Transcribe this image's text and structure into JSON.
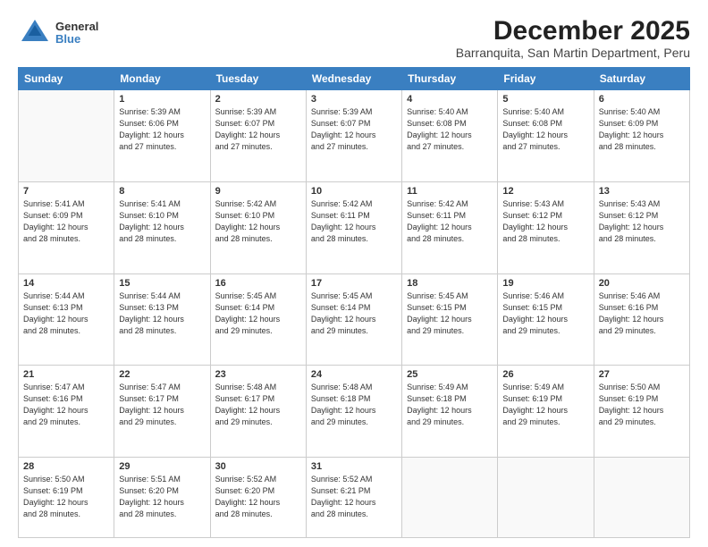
{
  "logo": {
    "general": "General",
    "blue": "Blue"
  },
  "title": "December 2025",
  "subtitle": "Barranquita, San Martin Department, Peru",
  "headers": [
    "Sunday",
    "Monday",
    "Tuesday",
    "Wednesday",
    "Thursday",
    "Friday",
    "Saturday"
  ],
  "weeks": [
    [
      {
        "day": "",
        "info": ""
      },
      {
        "day": "1",
        "info": "Sunrise: 5:39 AM\nSunset: 6:06 PM\nDaylight: 12 hours\nand 27 minutes."
      },
      {
        "day": "2",
        "info": "Sunrise: 5:39 AM\nSunset: 6:07 PM\nDaylight: 12 hours\nand 27 minutes."
      },
      {
        "day": "3",
        "info": "Sunrise: 5:39 AM\nSunset: 6:07 PM\nDaylight: 12 hours\nand 27 minutes."
      },
      {
        "day": "4",
        "info": "Sunrise: 5:40 AM\nSunset: 6:08 PM\nDaylight: 12 hours\nand 27 minutes."
      },
      {
        "day": "5",
        "info": "Sunrise: 5:40 AM\nSunset: 6:08 PM\nDaylight: 12 hours\nand 27 minutes."
      },
      {
        "day": "6",
        "info": "Sunrise: 5:40 AM\nSunset: 6:09 PM\nDaylight: 12 hours\nand 28 minutes."
      }
    ],
    [
      {
        "day": "7",
        "info": "Sunrise: 5:41 AM\nSunset: 6:09 PM\nDaylight: 12 hours\nand 28 minutes."
      },
      {
        "day": "8",
        "info": "Sunrise: 5:41 AM\nSunset: 6:10 PM\nDaylight: 12 hours\nand 28 minutes."
      },
      {
        "day": "9",
        "info": "Sunrise: 5:42 AM\nSunset: 6:10 PM\nDaylight: 12 hours\nand 28 minutes."
      },
      {
        "day": "10",
        "info": "Sunrise: 5:42 AM\nSunset: 6:11 PM\nDaylight: 12 hours\nand 28 minutes."
      },
      {
        "day": "11",
        "info": "Sunrise: 5:42 AM\nSunset: 6:11 PM\nDaylight: 12 hours\nand 28 minutes."
      },
      {
        "day": "12",
        "info": "Sunrise: 5:43 AM\nSunset: 6:12 PM\nDaylight: 12 hours\nand 28 minutes."
      },
      {
        "day": "13",
        "info": "Sunrise: 5:43 AM\nSunset: 6:12 PM\nDaylight: 12 hours\nand 28 minutes."
      }
    ],
    [
      {
        "day": "14",
        "info": "Sunrise: 5:44 AM\nSunset: 6:13 PM\nDaylight: 12 hours\nand 28 minutes."
      },
      {
        "day": "15",
        "info": "Sunrise: 5:44 AM\nSunset: 6:13 PM\nDaylight: 12 hours\nand 28 minutes."
      },
      {
        "day": "16",
        "info": "Sunrise: 5:45 AM\nSunset: 6:14 PM\nDaylight: 12 hours\nand 29 minutes."
      },
      {
        "day": "17",
        "info": "Sunrise: 5:45 AM\nSunset: 6:14 PM\nDaylight: 12 hours\nand 29 minutes."
      },
      {
        "day": "18",
        "info": "Sunrise: 5:45 AM\nSunset: 6:15 PM\nDaylight: 12 hours\nand 29 minutes."
      },
      {
        "day": "19",
        "info": "Sunrise: 5:46 AM\nSunset: 6:15 PM\nDaylight: 12 hours\nand 29 minutes."
      },
      {
        "day": "20",
        "info": "Sunrise: 5:46 AM\nSunset: 6:16 PM\nDaylight: 12 hours\nand 29 minutes."
      }
    ],
    [
      {
        "day": "21",
        "info": "Sunrise: 5:47 AM\nSunset: 6:16 PM\nDaylight: 12 hours\nand 29 minutes."
      },
      {
        "day": "22",
        "info": "Sunrise: 5:47 AM\nSunset: 6:17 PM\nDaylight: 12 hours\nand 29 minutes."
      },
      {
        "day": "23",
        "info": "Sunrise: 5:48 AM\nSunset: 6:17 PM\nDaylight: 12 hours\nand 29 minutes."
      },
      {
        "day": "24",
        "info": "Sunrise: 5:48 AM\nSunset: 6:18 PM\nDaylight: 12 hours\nand 29 minutes."
      },
      {
        "day": "25",
        "info": "Sunrise: 5:49 AM\nSunset: 6:18 PM\nDaylight: 12 hours\nand 29 minutes."
      },
      {
        "day": "26",
        "info": "Sunrise: 5:49 AM\nSunset: 6:19 PM\nDaylight: 12 hours\nand 29 minutes."
      },
      {
        "day": "27",
        "info": "Sunrise: 5:50 AM\nSunset: 6:19 PM\nDaylight: 12 hours\nand 29 minutes."
      }
    ],
    [
      {
        "day": "28",
        "info": "Sunrise: 5:50 AM\nSunset: 6:19 PM\nDaylight: 12 hours\nand 28 minutes."
      },
      {
        "day": "29",
        "info": "Sunrise: 5:51 AM\nSunset: 6:20 PM\nDaylight: 12 hours\nand 28 minutes."
      },
      {
        "day": "30",
        "info": "Sunrise: 5:52 AM\nSunset: 6:20 PM\nDaylight: 12 hours\nand 28 minutes."
      },
      {
        "day": "31",
        "info": "Sunrise: 5:52 AM\nSunset: 6:21 PM\nDaylight: 12 hours\nand 28 minutes."
      },
      {
        "day": "",
        "info": ""
      },
      {
        "day": "",
        "info": ""
      },
      {
        "day": "",
        "info": ""
      }
    ]
  ]
}
